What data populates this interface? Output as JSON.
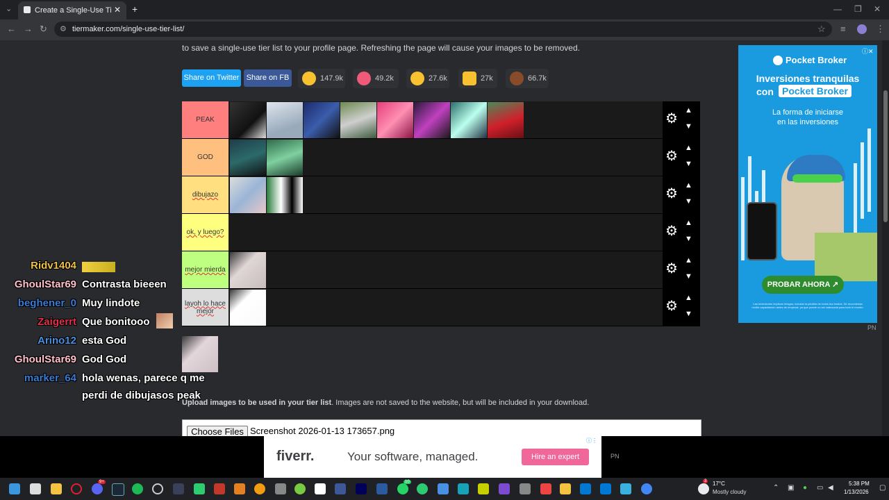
{
  "browser": {
    "tab_title": "Create a Single-Use Tier List (P",
    "url": "tiermaker.com/single-use-tier-list/",
    "new_tab": "+",
    "close": "✕"
  },
  "page": {
    "intro": "to save a single-use tier list to your profile page. Refreshing the page will cause your images to be removed.",
    "share_twitter": "Share on Twitter",
    "share_fb": "Share on FB",
    "reactions": [
      {
        "icon": "grin-emoji",
        "count": "147.9k",
        "color": "#f7c12f"
      },
      {
        "icon": "heart-eyes-emoji",
        "count": "49.2k",
        "color": "#f05a7a"
      },
      {
        "icon": "laugh-emoji",
        "count": "27.6k",
        "color": "#f7c12f"
      },
      {
        "icon": "hands-emoji",
        "count": "27k",
        "color": "#f7c12f"
      },
      {
        "icon": "poop-emoji",
        "count": "66.7k",
        "color": "#8a4b2b"
      }
    ],
    "tiers": [
      {
        "label": "PEAK",
        "color": "#ff7f7f",
        "images": 8
      },
      {
        "label": "GOD",
        "color": "#ffbf7f",
        "images": 2
      },
      {
        "label": "dibujazo",
        "color": "#ffdf7f",
        "images": 2
      },
      {
        "label": "ok, y luego?",
        "color": "#ffff7f",
        "images": 0
      },
      {
        "label": "mejor mierda",
        "color": "#bfff7f",
        "images": 1
      },
      {
        "label": "layoh lo hace mejor",
        "color": "#dddddd",
        "images": 1
      }
    ],
    "upload_bold": "Upload images to be used in your tier list",
    "upload_rest": ". Images are not saved to the website, but will be included in your download.",
    "choose_files": "Choose Files",
    "file_name": "Screenshot 2026-01-13 173657.png"
  },
  "chat": [
    {
      "user": "Ridv1404",
      "color": "#f0c040",
      "msg": ""
    },
    {
      "user": "GhoulStar69",
      "color": "#ffc0cb",
      "msg": "Contrasta bieeen"
    },
    {
      "user": "beghener_0",
      "color": "#3a7bd5",
      "msg": "Muy lindote"
    },
    {
      "user": "Zaigerrt",
      "color": "#e0304a",
      "msg": "Que bonitooo"
    },
    {
      "user": "Arino12",
      "color": "#4a90e2",
      "msg": "esta God"
    },
    {
      "user": "GhoulStar69",
      "color": "#ffc0cb",
      "msg": "God God"
    },
    {
      "user": "marker_64",
      "color": "#3a7bd5",
      "msg": "hola wenas, parece q me"
    },
    {
      "user": "",
      "color": "#ffffff",
      "msg": "perdi de dibujasos peak"
    }
  ],
  "ad_right": {
    "brand": "Pocket Broker",
    "headline_1": "Inversiones tranquilas",
    "headline_2": "con",
    "headline_brand": "Pocket Broker",
    "sub_1": "La forma de iniciarse",
    "sub_2": "en las inversiones",
    "cta": "PROBAR AHORA",
    "fine": "Las inversiones implican riesgos, incluida la pérdida de todos tus fondos. Se recomienda recibir capacitación antes de empezar, ya que puede no ser adecuada para todo el mundo."
  },
  "ad_bottom": {
    "brand": "fiverr.",
    "text": "Your software, managed.",
    "cta": "Hire an expert"
  },
  "pn": "PN",
  "taskbar": {
    "weather_temp": "17°C",
    "weather_desc": "Mostly cloudy",
    "time": "5:38 PM",
    "date": "1/13/2026",
    "notif": "3",
    "badge_discord": "9+",
    "badge_whatsapp": "10"
  }
}
